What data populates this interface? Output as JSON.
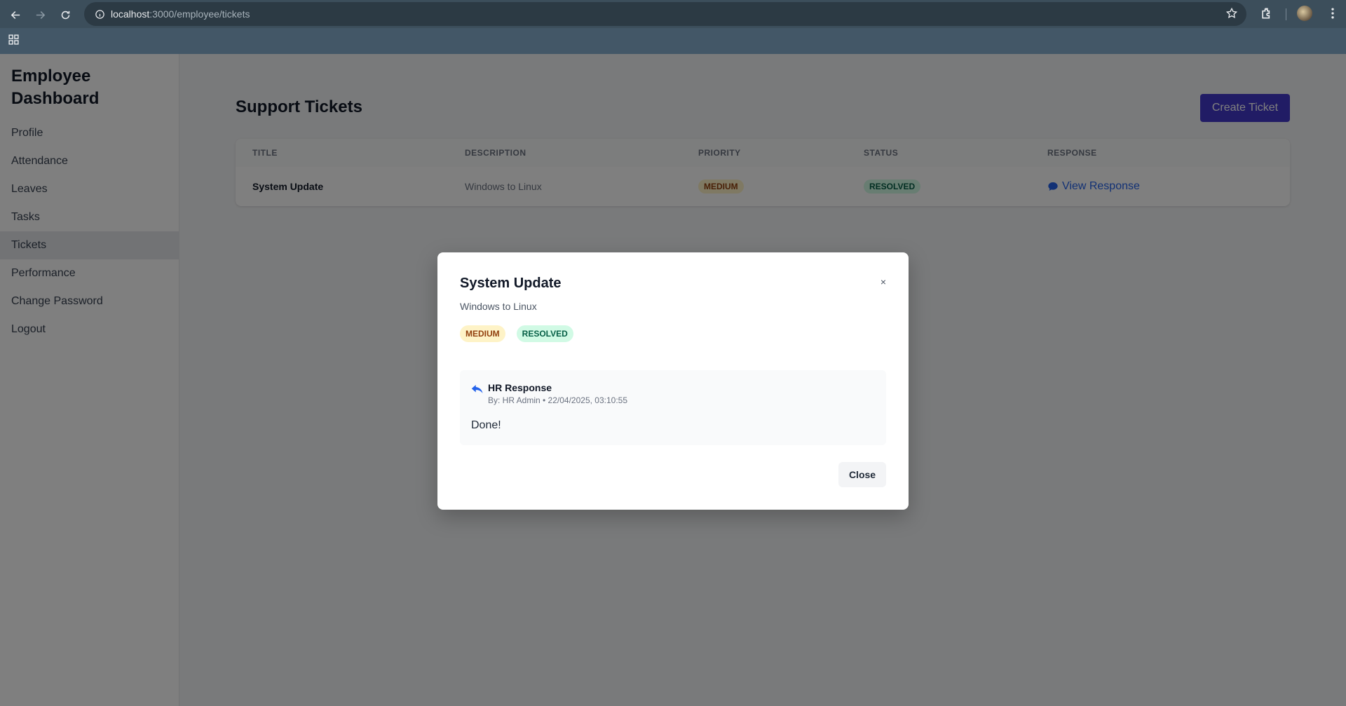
{
  "browser": {
    "url_host": "localhost",
    "url_path": ":3000/employee/tickets"
  },
  "sidebar": {
    "brand": "Employee Dashboard",
    "items": [
      {
        "label": "Profile"
      },
      {
        "label": "Attendance"
      },
      {
        "label": "Leaves"
      },
      {
        "label": "Tasks"
      },
      {
        "label": "Tickets"
      },
      {
        "label": "Performance"
      },
      {
        "label": "Change Password"
      },
      {
        "label": "Logout"
      }
    ],
    "active": "Tickets"
  },
  "main": {
    "title": "Support Tickets",
    "create_button": "Create Ticket",
    "table": {
      "columns": [
        "TITLE",
        "DESCRIPTION",
        "PRIORITY",
        "STATUS",
        "RESPONSE"
      ],
      "rows": [
        {
          "title": "System Update",
          "description": "Windows to Linux",
          "priority": "MEDIUM",
          "status": "RESOLVED",
          "response_link": "View Response"
        }
      ]
    }
  },
  "modal": {
    "title": "System Update",
    "close_x": "×",
    "description": "Windows to Linux",
    "priority": "MEDIUM",
    "status": "RESOLVED",
    "response_heading": "HR Response",
    "response_meta": "By: HR Admin • 22/04/2025, 03:10:55",
    "response_text": "Done!",
    "close_button": "Close"
  },
  "colors": {
    "primary": "#4338ca",
    "link": "#2563eb",
    "medium_badge_bg": "#fef3c7",
    "resolved_badge_bg": "#d1fae5"
  }
}
